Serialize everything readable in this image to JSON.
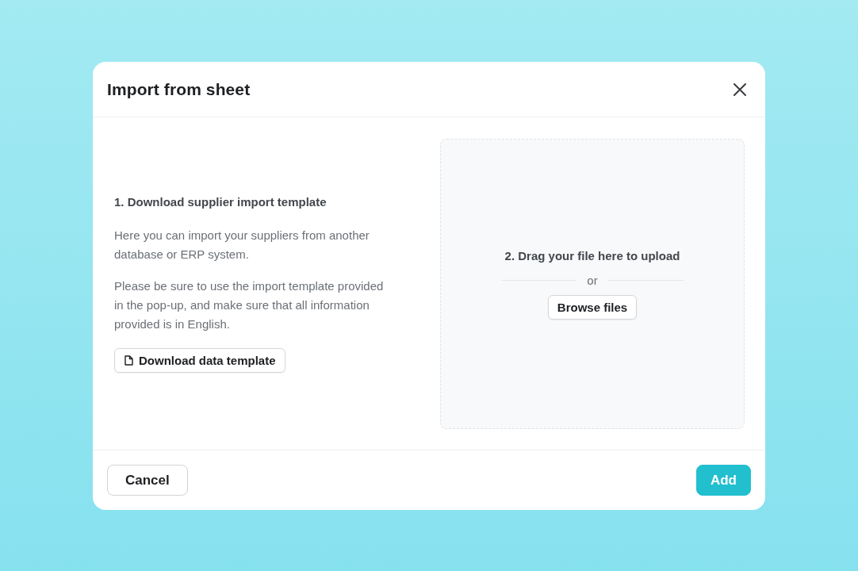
{
  "dialog": {
    "title": "Import from sheet"
  },
  "instructions": {
    "heading": "1. Download supplier import template",
    "paragraphs": [
      "Here you can import your suppliers from another database or ERP system.",
      "Please be sure to use the import template provided in the pop-up, and make sure that all information provided is in English."
    ],
    "download_button": "Download data template"
  },
  "upload": {
    "heading": "2. Drag your file here to upload",
    "separator": "or",
    "browse_button": "Browse files"
  },
  "footer": {
    "buttons": [
      {
        "label": "Cancel",
        "kind": "secondary"
      },
      {
        "label": "Add",
        "kind": "primary"
      }
    ]
  }
}
